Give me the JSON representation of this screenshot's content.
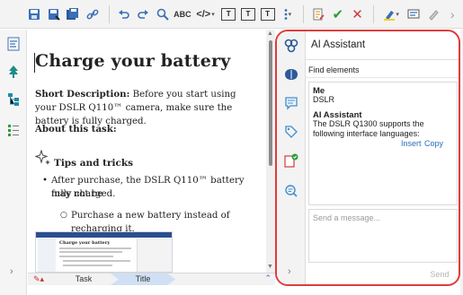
{
  "toolbar": {
    "icons": [
      "save-icon",
      "save-as-icon",
      "save-all-icon",
      "link-icon",
      "undo-icon",
      "redo-icon",
      "find-icon",
      "spellcheck-icon",
      "tags-icon",
      "insert-element-icon",
      "insert-text-icon",
      "insert-table-icon",
      "more-icon",
      "track-changes-icon",
      "accept-change-icon",
      "reject-change-icon",
      "highlight-icon",
      "comment-icon",
      "forward-icon"
    ],
    "spellcheck_label": "ABC",
    "tags_label": "</>",
    "box1_label": "T",
    "box2_label": "T",
    "box3_label": "T"
  },
  "document": {
    "title": "Charge your battery",
    "short_desc_label": "Short Description:",
    "short_desc_text": " Before you start using your DSLR Q110™ camera, make sure the battery is fully charged.",
    "about_label": "About this task:",
    "tips_label": "Tips and tricks",
    "bullet1_line1": "After purchase, the DSLR Q110™ battery may not be",
    "bullet1_line2": "fully charged.",
    "sub_bullet1": "Purchase a new battery instead of recharging it.",
    "thumbnail_title": "Charge your battery"
  },
  "breadcrumb": {
    "items": [
      "Task",
      "Title"
    ]
  },
  "ai_assistant": {
    "title": "AI Assistant",
    "find_elements": "Find elements",
    "messages": [
      {
        "sender": "Me",
        "text": "DSLR"
      },
      {
        "sender": "AI Assistant",
        "text": "The DSLR Q1300 supports the following interface languages:"
      }
    ],
    "insert_label": "Insert",
    "copy_label": "Copy",
    "input_placeholder": "Send a message...",
    "send_label": "Send"
  },
  "colors": {
    "highlight_border": "#e03c3c",
    "accent": "#3b6fb6",
    "link": "#2a6ebb"
  }
}
